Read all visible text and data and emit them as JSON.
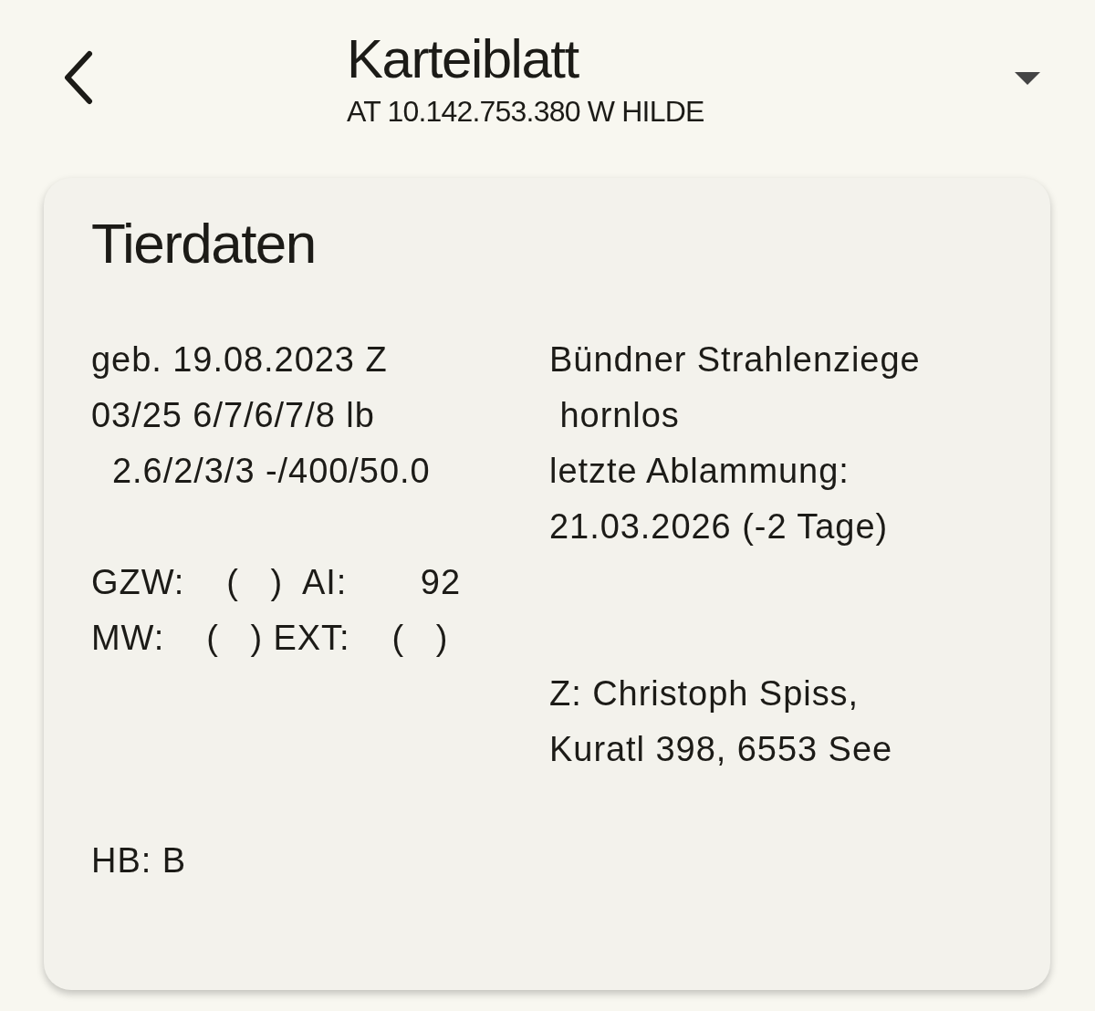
{
  "header": {
    "title": "Karteiblatt",
    "subtitle": "AT 10.142.753.380 W HILDE"
  },
  "card": {
    "title": "Tierdaten",
    "lines": [
      {
        "left": "geb. 19.08.2023 Z",
        "right": "Bündner Strahlenziege"
      },
      {
        "left": "03/25 6/7/6/7/8 lb",
        "right": " hornlos"
      },
      {
        "left": "  2.6/2/3/3 -/400/50.0",
        "right": "letzte Ablammung:"
      },
      {
        "right": "21.03.2026 (-2 Tage)"
      },
      {
        "left": "GZW:    (   )  AI:       92"
      },
      {
        "left": "MW:    (   ) EXT:    (   )"
      },
      {
        "right": "Z: Christoph Spiss,"
      },
      {
        "right": "Kuratl 398, 6553 See"
      }
    ],
    "footer": "HB: B"
  }
}
